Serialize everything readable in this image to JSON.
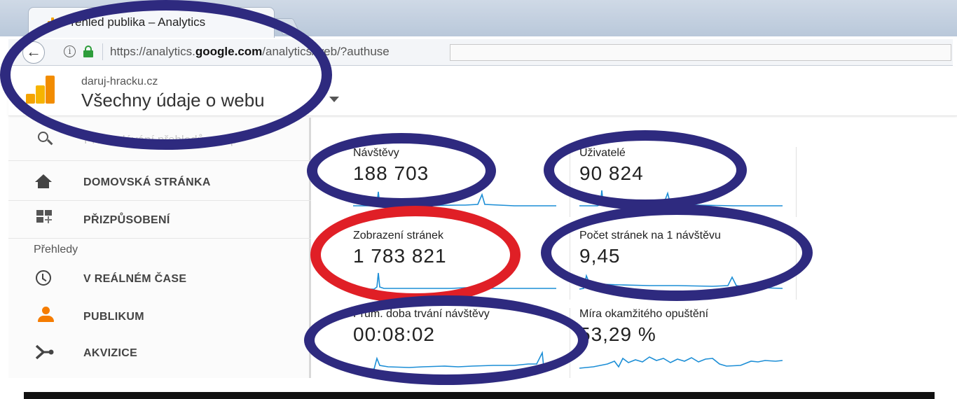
{
  "browser": {
    "tab_title": "Přehled publika – Analytics",
    "tab_close": "×",
    "url_prefix": "https://analytics.",
    "url_domain": "google.com",
    "url_path": "/analytics/web/?authuse"
  },
  "header": {
    "account": "daruj-hracku.cz",
    "property": "Všechny údaje o webu"
  },
  "sidebar": {
    "search_placeholder": "Prohledávání přehledů a náp",
    "section_reports": "Přehledy",
    "items": [
      {
        "label": "DOMOVSKÁ STRÁNKA",
        "icon": "home-icon"
      },
      {
        "label": "PŘIZPŮSOBENÍ",
        "icon": "dashboard-icon"
      },
      {
        "label": "V REÁLNÉM ČASE",
        "icon": "clock-icon"
      },
      {
        "label": "PUBLIKUM",
        "icon": "person-icon"
      },
      {
        "label": "AKVIZICE",
        "icon": "acquisition-icon"
      }
    ]
  },
  "metrics": [
    {
      "label": "Návštěvy",
      "value": "188 703"
    },
    {
      "label": "Uživatelé",
      "value": "90 824"
    },
    {
      "label": "Zobrazení stránek",
      "value": "1 783 821"
    },
    {
      "label": "Počet stránek na 1 návštěvu",
      "value": "9,45"
    },
    {
      "label": "Prům. doba trvání návštěvy",
      "value": "00:08:02"
    },
    {
      "label": "Míra okamžitého opuštění",
      "value": "53,29 %"
    }
  ],
  "colors": {
    "annotation_blue": "#2e2a7f",
    "annotation_red": "#e01f26",
    "sparkline": "#1c8ed6",
    "ga_orange": "#f4a300"
  }
}
